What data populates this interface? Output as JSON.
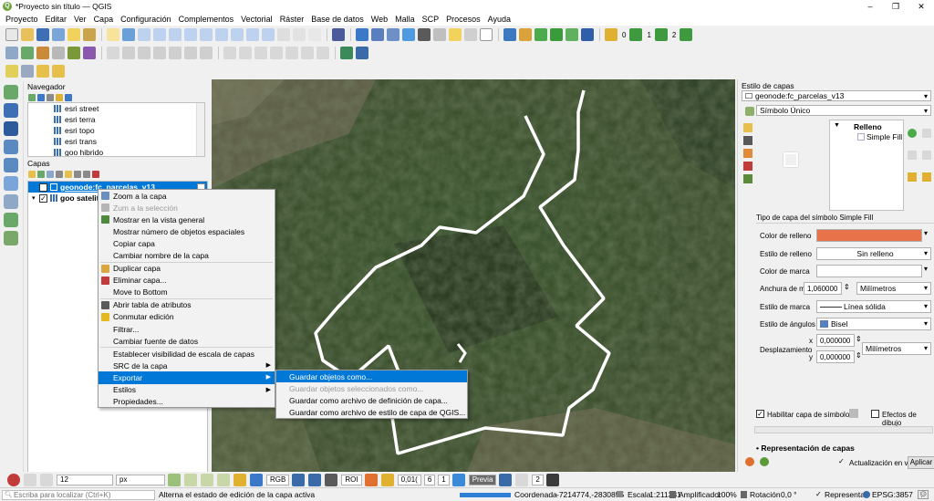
{
  "window": {
    "title": "*Proyecto sin título — QGIS",
    "minimize": "–",
    "restore": "❐",
    "close": "✕"
  },
  "menubar": [
    "Proyecto",
    "Editar",
    "Ver",
    "Capa",
    "Configuración",
    "Complementos",
    "Vectorial",
    "Ráster",
    "Base de datos",
    "Web",
    "Malla",
    "SCP",
    "Procesos",
    "Ayuda"
  ],
  "toolbar": {
    "spin1": "0",
    "spin2": "1",
    "spin3": "2"
  },
  "navigator": {
    "title": "Navegador",
    "items": [
      "esri street",
      "esri terra",
      "esri topo",
      "esri trans",
      "goo hibrido"
    ]
  },
  "layers": {
    "title": "Capas",
    "rows": [
      {
        "label": "geonode:fc_parcelas_v13",
        "checked": true,
        "selected": true
      },
      {
        "label": "goo satelite",
        "checked": true,
        "selected": false
      }
    ]
  },
  "context_menu": {
    "items": [
      {
        "label": "Zoom a la capa",
        "disabled": false,
        "icon": "zoom-layer-icon",
        "color": "#6a8fbf"
      },
      {
        "label": "Zum a la selección",
        "disabled": true,
        "icon": "zoom-selection-icon",
        "color": "#b5b5b5"
      },
      {
        "label": "Mostrar en la vista general",
        "disabled": false,
        "icon": "overview-icon",
        "color": "#4e8a3e"
      },
      {
        "label": "Mostrar número de objetos espaciales",
        "disabled": false
      },
      {
        "label": "Copiar capa",
        "disabled": false
      },
      {
        "label": "Cambiar nombre de la capa",
        "disabled": false
      },
      {
        "sep": true
      },
      {
        "label": "Duplicar capa",
        "disabled": false,
        "icon": "duplicate-icon",
        "color": "#d9a640"
      },
      {
        "label": "Eliminar capa...",
        "disabled": false,
        "icon": "remove-icon",
        "color": "#c23b3b"
      },
      {
        "label": "Move to Bottom",
        "disabled": false
      },
      {
        "sep": true
      },
      {
        "label": "Abrir tabla de atributos",
        "disabled": false,
        "icon": "table-icon",
        "color": "#5a5a5a"
      },
      {
        "label": "Conmutar edición",
        "disabled": false,
        "icon": "pencil-icon",
        "color": "#e5b820"
      },
      {
        "label": "Filtrar...",
        "disabled": false
      },
      {
        "label": "Cambiar fuente de datos",
        "disabled": false
      },
      {
        "sep": true
      },
      {
        "label": "Establecer visibilidad de escala de capas",
        "disabled": false
      },
      {
        "label": "SRC de la capa",
        "disabled": false,
        "submenu": true
      },
      {
        "label": "Exportar",
        "disabled": false,
        "submenu": true,
        "highlight": true
      },
      {
        "label": "Estilos",
        "disabled": false,
        "submenu": true
      },
      {
        "label": "Propiedades...",
        "disabled": false
      }
    ]
  },
  "export_submenu": {
    "items": [
      {
        "label": "Guardar objetos como...",
        "highlight": true,
        "disabled": false
      },
      {
        "label": "Guardar objetos seleccionados como...",
        "highlight": false,
        "disabled": true
      },
      {
        "label": "Guardar como archivo de definición de capa...",
        "highlight": false,
        "disabled": false
      },
      {
        "label": "Guardar como archivo de estilo de capa de QGIS...",
        "highlight": false,
        "disabled": false
      }
    ]
  },
  "style_panel": {
    "title": "Estilo de capas",
    "layer_combo": "geonode:fc_parcelas_v13",
    "renderer_combo": "Símbolo Único",
    "tree_root": "Relleno",
    "tree_child": "Simple Fill",
    "symbol_layer_type_label": "Tipo de capa del símbolo",
    "symbol_layer_type_value": "Simple Fill",
    "fill_color_label": "Color de relleno",
    "fill_color": "#e8734a",
    "fill_style_label": "Estilo de relleno",
    "fill_style_value": "Sin relleno",
    "stroke_color_label": "Color de marca",
    "stroke_width_label": "Anchura de marca",
    "stroke_width_value": "1,060000",
    "stroke_width_unit": "Milímetros",
    "stroke_style_label": "Estilo de marca",
    "stroke_style_value": "Línea sólida",
    "join_style_label": "Estilo de ángulos",
    "join_style_value": "Bisel",
    "offset_label": "Desplazamiento",
    "offset_x_label": "x",
    "offset_x": "0,000000",
    "offset_y_label": "y",
    "offset_y": "0,000000",
    "offset_unit": "Milímetros",
    "enable_layer_label": "Habilitar capa de símbolos",
    "draw_effects_label": "Efectos de dibujo",
    "rendering_section": "Representación de capas",
    "live_update_label": "Actualización en vivo",
    "apply_button": "Aplicar"
  },
  "bottom_toolbar": {
    "size_value": "12",
    "size_unit": "px",
    "rgb_label": "RGB",
    "roi_label": "ROI",
    "v1": "0,01(",
    "v2": "6",
    "v3": "1",
    "preview": "Previa",
    "v4": "2"
  },
  "statusbar": {
    "search_placeholder": "Escriba para localizar (Ctrl+K)",
    "message": "Alterna el estado de edición de la capa activa",
    "coord_label": "Coordenada",
    "coord_value": "-7214774,-2830855",
    "scale_label": "Escala",
    "scale_value": "1:211331",
    "magnifier_label": "Amplificador",
    "magnifier_value": "100%",
    "rotation_label": "Rotación",
    "rotation_value": "0,0 °",
    "render_label": "Representar",
    "crs_value": "EPSG:3857"
  }
}
